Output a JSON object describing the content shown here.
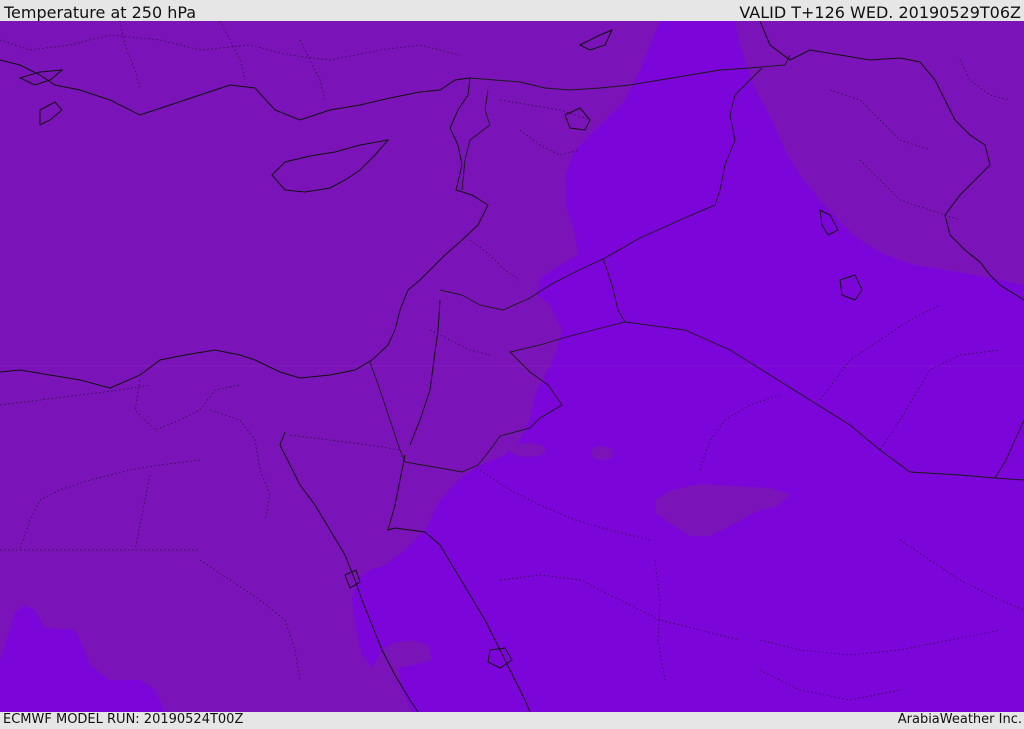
{
  "header": {
    "title": "Temperature at 250 hPa",
    "valid": "VALID T+126 WED. 20190529T06Z"
  },
  "footer": {
    "model_run": "ECMWF MODEL RUN: 20190524T00Z",
    "credit": "ArabiaWeather Inc."
  },
  "map": {
    "parameter": "temperature-250hpa",
    "colors": {
      "warmer_band": "#7a14b8",
      "colder_band": "#7c05d9",
      "coastline": "#111111",
      "borders": "#1a1a1a",
      "frame_background": "#e6e6e6"
    }
  }
}
